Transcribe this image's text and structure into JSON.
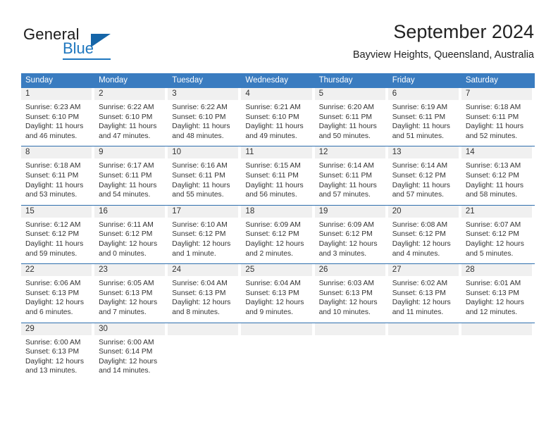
{
  "logo": {
    "word_top": "General",
    "word_bottom": "Blue",
    "icon": "triangle-mark"
  },
  "header": {
    "title": "September 2024",
    "location": "Bayview Heights, Queensland, Australia"
  },
  "weekdays": [
    "Sunday",
    "Monday",
    "Tuesday",
    "Wednesday",
    "Thursday",
    "Friday",
    "Saturday"
  ],
  "colors": {
    "header_band": "#3a7cc0",
    "row_rule": "#2f6fae",
    "daynum_band": "#f0f0f0",
    "logo_blue": "#1f77bf",
    "text": "#333333"
  },
  "weeks": [
    [
      {
        "day": "1",
        "sunrise": "Sunrise: 6:23 AM",
        "sunset": "Sunset: 6:10 PM",
        "daylight1": "Daylight: 11 hours",
        "daylight2": "and 46 minutes."
      },
      {
        "day": "2",
        "sunrise": "Sunrise: 6:22 AM",
        "sunset": "Sunset: 6:10 PM",
        "daylight1": "Daylight: 11 hours",
        "daylight2": "and 47 minutes."
      },
      {
        "day": "3",
        "sunrise": "Sunrise: 6:22 AM",
        "sunset": "Sunset: 6:10 PM",
        "daylight1": "Daylight: 11 hours",
        "daylight2": "and 48 minutes."
      },
      {
        "day": "4",
        "sunrise": "Sunrise: 6:21 AM",
        "sunset": "Sunset: 6:10 PM",
        "daylight1": "Daylight: 11 hours",
        "daylight2": "and 49 minutes."
      },
      {
        "day": "5",
        "sunrise": "Sunrise: 6:20 AM",
        "sunset": "Sunset: 6:11 PM",
        "daylight1": "Daylight: 11 hours",
        "daylight2": "and 50 minutes."
      },
      {
        "day": "6",
        "sunrise": "Sunrise: 6:19 AM",
        "sunset": "Sunset: 6:11 PM",
        "daylight1": "Daylight: 11 hours",
        "daylight2": "and 51 minutes."
      },
      {
        "day": "7",
        "sunrise": "Sunrise: 6:18 AM",
        "sunset": "Sunset: 6:11 PM",
        "daylight1": "Daylight: 11 hours",
        "daylight2": "and 52 minutes."
      }
    ],
    [
      {
        "day": "8",
        "sunrise": "Sunrise: 6:18 AM",
        "sunset": "Sunset: 6:11 PM",
        "daylight1": "Daylight: 11 hours",
        "daylight2": "and 53 minutes."
      },
      {
        "day": "9",
        "sunrise": "Sunrise: 6:17 AM",
        "sunset": "Sunset: 6:11 PM",
        "daylight1": "Daylight: 11 hours",
        "daylight2": "and 54 minutes."
      },
      {
        "day": "10",
        "sunrise": "Sunrise: 6:16 AM",
        "sunset": "Sunset: 6:11 PM",
        "daylight1": "Daylight: 11 hours",
        "daylight2": "and 55 minutes."
      },
      {
        "day": "11",
        "sunrise": "Sunrise: 6:15 AM",
        "sunset": "Sunset: 6:11 PM",
        "daylight1": "Daylight: 11 hours",
        "daylight2": "and 56 minutes."
      },
      {
        "day": "12",
        "sunrise": "Sunrise: 6:14 AM",
        "sunset": "Sunset: 6:11 PM",
        "daylight1": "Daylight: 11 hours",
        "daylight2": "and 57 minutes."
      },
      {
        "day": "13",
        "sunrise": "Sunrise: 6:14 AM",
        "sunset": "Sunset: 6:12 PM",
        "daylight1": "Daylight: 11 hours",
        "daylight2": "and 57 minutes."
      },
      {
        "day": "14",
        "sunrise": "Sunrise: 6:13 AM",
        "sunset": "Sunset: 6:12 PM",
        "daylight1": "Daylight: 11 hours",
        "daylight2": "and 58 minutes."
      }
    ],
    [
      {
        "day": "15",
        "sunrise": "Sunrise: 6:12 AM",
        "sunset": "Sunset: 6:12 PM",
        "daylight1": "Daylight: 11 hours",
        "daylight2": "and 59 minutes."
      },
      {
        "day": "16",
        "sunrise": "Sunrise: 6:11 AM",
        "sunset": "Sunset: 6:12 PM",
        "daylight1": "Daylight: 12 hours",
        "daylight2": "and 0 minutes."
      },
      {
        "day": "17",
        "sunrise": "Sunrise: 6:10 AM",
        "sunset": "Sunset: 6:12 PM",
        "daylight1": "Daylight: 12 hours",
        "daylight2": "and 1 minute."
      },
      {
        "day": "18",
        "sunrise": "Sunrise: 6:09 AM",
        "sunset": "Sunset: 6:12 PM",
        "daylight1": "Daylight: 12 hours",
        "daylight2": "and 2 minutes."
      },
      {
        "day": "19",
        "sunrise": "Sunrise: 6:09 AM",
        "sunset": "Sunset: 6:12 PM",
        "daylight1": "Daylight: 12 hours",
        "daylight2": "and 3 minutes."
      },
      {
        "day": "20",
        "sunrise": "Sunrise: 6:08 AM",
        "sunset": "Sunset: 6:12 PM",
        "daylight1": "Daylight: 12 hours",
        "daylight2": "and 4 minutes."
      },
      {
        "day": "21",
        "sunrise": "Sunrise: 6:07 AM",
        "sunset": "Sunset: 6:12 PM",
        "daylight1": "Daylight: 12 hours",
        "daylight2": "and 5 minutes."
      }
    ],
    [
      {
        "day": "22",
        "sunrise": "Sunrise: 6:06 AM",
        "sunset": "Sunset: 6:13 PM",
        "daylight1": "Daylight: 12 hours",
        "daylight2": "and 6 minutes."
      },
      {
        "day": "23",
        "sunrise": "Sunrise: 6:05 AM",
        "sunset": "Sunset: 6:13 PM",
        "daylight1": "Daylight: 12 hours",
        "daylight2": "and 7 minutes."
      },
      {
        "day": "24",
        "sunrise": "Sunrise: 6:04 AM",
        "sunset": "Sunset: 6:13 PM",
        "daylight1": "Daylight: 12 hours",
        "daylight2": "and 8 minutes."
      },
      {
        "day": "25",
        "sunrise": "Sunrise: 6:04 AM",
        "sunset": "Sunset: 6:13 PM",
        "daylight1": "Daylight: 12 hours",
        "daylight2": "and 9 minutes."
      },
      {
        "day": "26",
        "sunrise": "Sunrise: 6:03 AM",
        "sunset": "Sunset: 6:13 PM",
        "daylight1": "Daylight: 12 hours",
        "daylight2": "and 10 minutes."
      },
      {
        "day": "27",
        "sunrise": "Sunrise: 6:02 AM",
        "sunset": "Sunset: 6:13 PM",
        "daylight1": "Daylight: 12 hours",
        "daylight2": "and 11 minutes."
      },
      {
        "day": "28",
        "sunrise": "Sunrise: 6:01 AM",
        "sunset": "Sunset: 6:13 PM",
        "daylight1": "Daylight: 12 hours",
        "daylight2": "and 12 minutes."
      }
    ],
    [
      {
        "day": "29",
        "sunrise": "Sunrise: 6:00 AM",
        "sunset": "Sunset: 6:13 PM",
        "daylight1": "Daylight: 12 hours",
        "daylight2": "and 13 minutes."
      },
      {
        "day": "30",
        "sunrise": "Sunrise: 6:00 AM",
        "sunset": "Sunset: 6:14 PM",
        "daylight1": "Daylight: 12 hours",
        "daylight2": "and 14 minutes."
      },
      {
        "day": "",
        "sunrise": "",
        "sunset": "",
        "daylight1": "",
        "daylight2": ""
      },
      {
        "day": "",
        "sunrise": "",
        "sunset": "",
        "daylight1": "",
        "daylight2": ""
      },
      {
        "day": "",
        "sunrise": "",
        "sunset": "",
        "daylight1": "",
        "daylight2": ""
      },
      {
        "day": "",
        "sunrise": "",
        "sunset": "",
        "daylight1": "",
        "daylight2": ""
      },
      {
        "day": "",
        "sunrise": "",
        "sunset": "",
        "daylight1": "",
        "daylight2": ""
      }
    ]
  ]
}
